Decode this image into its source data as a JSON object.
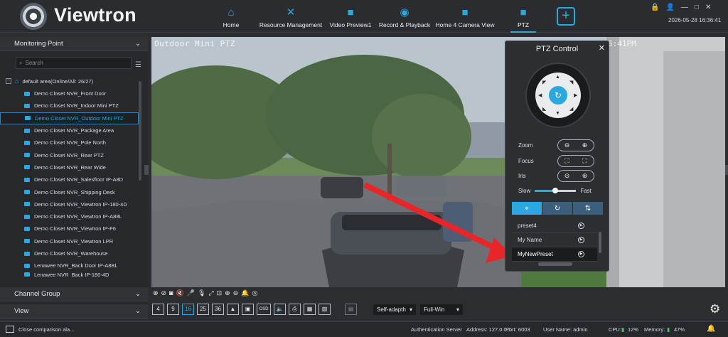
{
  "header": {
    "brand": "Viewtron",
    "nav": [
      {
        "label": "Home",
        "icon": "home-icon"
      },
      {
        "label": "Resource Management",
        "icon": "wrench-icon"
      },
      {
        "label": "Video Preview1",
        "icon": "video-camera-icon"
      },
      {
        "label": "Record & Playback",
        "icon": "film-reel-icon"
      },
      {
        "label": "Home 4 Camera View",
        "icon": "video-camera-icon"
      },
      {
        "label": "PTZ",
        "icon": "video-camera-icon"
      }
    ],
    "datetime": "2026-05-28 16:36:41"
  },
  "sidebar": {
    "monitoring_point": "Monitoring Point",
    "search_placeholder": "Search",
    "root_label": "default area(Online/All: 26/27)",
    "items": [
      "Demo Closet NVR_Front Door",
      "Demo Closet NVR_Indoor Mini PTZ",
      "Demo Closet NVR_Outdoor Mini PTZ",
      "Demo Closet NVR_Package Area",
      "Demo Closet NVR_Pole North",
      "Demo Closet NVR_Rear PTZ",
      "Demo Closet NVR_Rear Wide",
      "Demo Closet NVR_Salesfloor IP-A8D",
      "Demo Closet NVR_Shipping Desk",
      "Demo Closet NVR_Viewtron IP-180-4D",
      "Demo Closet NVR_Viewtron IP-A88L",
      "Demo Closet NVR_Viewtron IP-F6",
      "Demo Closet NVR_Viewtron LPR",
      "Demo Closet NVR_Warehouse",
      "Lenawee NVR_Back Door IP-A8BL",
      "Lenawee NVR_Back IP-180-4D"
    ],
    "channel_group": "Channel Group",
    "view": "View"
  },
  "video": {
    "title": "Outdoor Mini PTZ",
    "time_overlay": "6:41PM"
  },
  "ptz": {
    "title": "PTZ Control",
    "zoom": "Zoom",
    "focus": "Focus",
    "iris": "Iris",
    "slow": "Slow",
    "fast": "Fast",
    "speed_level": 0.5,
    "presets": [
      "preset4",
      "My Name",
      "MyNewPreset"
    ]
  },
  "layout_bar": {
    "buttons": [
      "4",
      "9",
      "16",
      "25",
      "36",
      "▲",
      "▣",
      "OSD",
      "🔈",
      "⎙",
      "▦",
      "▧"
    ],
    "mode": "Self-adapth",
    "window": "Full-Win"
  },
  "status": {
    "message": "Close comparison ala...",
    "auth": "Authentication Server",
    "address": "Address: 127.0.0.1",
    "port": "Port: 6003",
    "user": "User Name: admin",
    "cpu_label": "CPU:",
    "cpu": "12%",
    "memory_label": "Memory:",
    "memory": "47%"
  },
  "colors": {
    "accent": "#29a9e0",
    "arrow": "#e8262a"
  }
}
